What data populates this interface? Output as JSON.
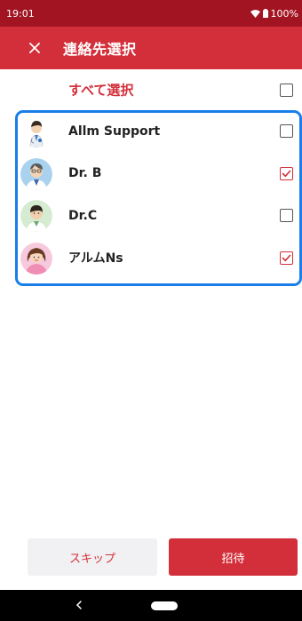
{
  "status_bar": {
    "time": "19:01",
    "battery": "100%"
  },
  "app_bar": {
    "title": "連絡先選択",
    "close_icon": "close-icon"
  },
  "select_all": {
    "label": "すべて選択",
    "checked": false
  },
  "contacts": [
    {
      "name": "Allm Support",
      "checked": false,
      "avatar": "doctor-support-avatar"
    },
    {
      "name": "Dr. B",
      "checked": true,
      "avatar": "doctor-b-avatar"
    },
    {
      "name": "Dr.C",
      "checked": false,
      "avatar": "doctor-c-avatar"
    },
    {
      "name": "アルムNs",
      "checked": true,
      "avatar": "nurse-avatar"
    }
  ],
  "buttons": {
    "skip": "スキップ",
    "invite": "招待"
  },
  "colors": {
    "primary": "#d32f3a",
    "status_bar": "#a31422",
    "highlight": "#1a7ee8"
  }
}
